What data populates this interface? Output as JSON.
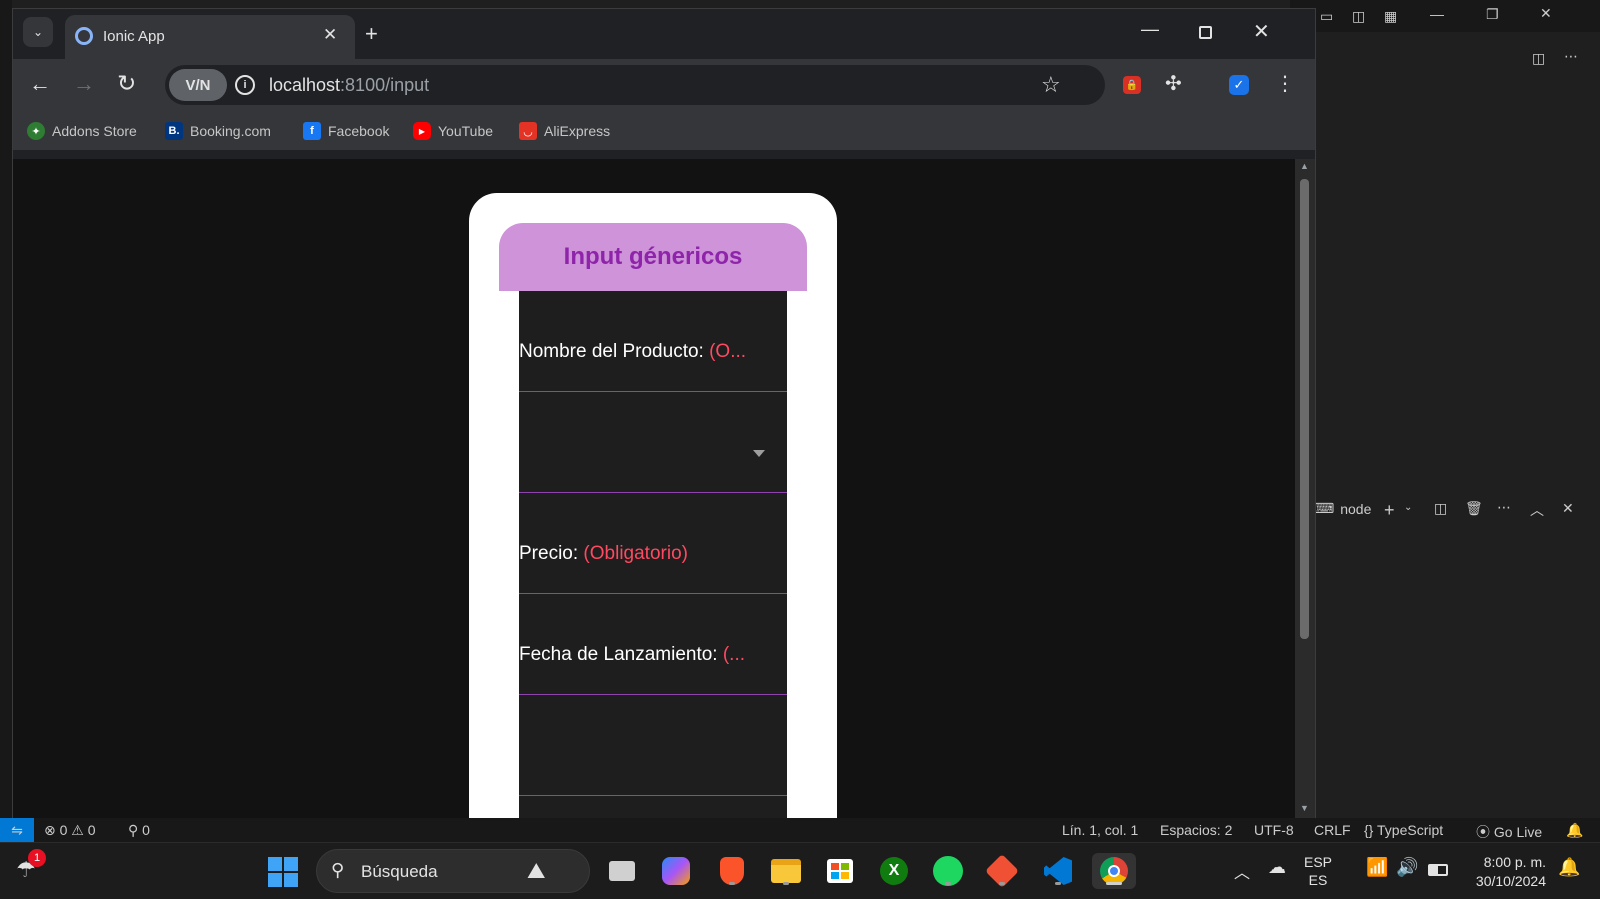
{
  "browser": {
    "tab_title": "Ionic App",
    "url_host": "localhost",
    "url_path": ":8100/input",
    "vpn_label": "V/N",
    "bookmarks": [
      {
        "label": "Addons Store",
        "icon": "addons-store-icon",
        "color": "#2e7d32"
      },
      {
        "label": "Booking.com",
        "icon": "booking-icon",
        "color": "#003580"
      },
      {
        "label": "Facebook",
        "icon": "facebook-icon",
        "color": "#1877f2"
      },
      {
        "label": "YouTube",
        "icon": "youtube-icon",
        "color": "#ff0000"
      },
      {
        "label": "AliExpress",
        "icon": "aliexpress-icon",
        "color": "#e43225"
      }
    ]
  },
  "app": {
    "header_title": "Input génericos",
    "accent_header_bg": "#ce93d8",
    "accent_header_text": "#8e24aa",
    "fields": [
      {
        "label": "Nombre del Producto: ",
        "required": "(O..."
      },
      {
        "label": "",
        "required": "",
        "type": "select"
      },
      {
        "label": "Precio: ",
        "required": "(Obligatorio)"
      },
      {
        "label": "Fecha de Lanzamiento: ",
        "required": "(..."
      },
      {
        "label": "",
        "required": ""
      }
    ]
  },
  "vscode": {
    "terminal_label": "node",
    "status": {
      "errors": "0",
      "warnings": "0",
      "ports": "0",
      "position": "Lín. 1, col. 1",
      "spaces": "Espacios: 2",
      "encoding": "UTF-8",
      "eol": "CRLF",
      "language": "TypeScript",
      "golive": "Go Live"
    }
  },
  "taskbar": {
    "search_placeholder": "Búsqueda",
    "weather_badge": "1",
    "lang_top": "ESP",
    "lang_bottom": "ES",
    "time": "8:00 p. m.",
    "date": "30/10/2024"
  }
}
